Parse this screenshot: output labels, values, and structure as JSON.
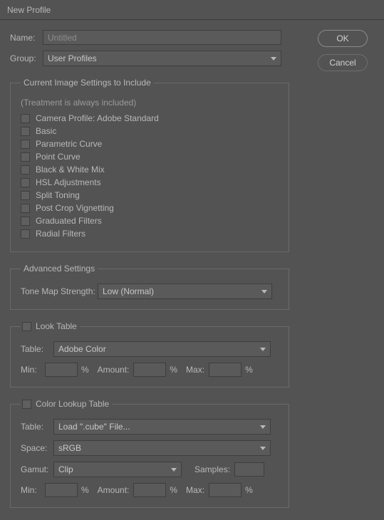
{
  "window": {
    "title": "New Profile"
  },
  "form": {
    "name_label": "Name:",
    "name_placeholder": "Untitled",
    "name_value": "",
    "group_label": "Group:",
    "group_value": "User Profiles"
  },
  "include": {
    "legend": "Current Image Settings to Include",
    "note": "(Treatment is always included)",
    "items": [
      "Camera Profile: Adobe Standard",
      "Basic",
      "Parametric Curve",
      "Point Curve",
      "Black & White Mix",
      "HSL Adjustments",
      "Split Toning",
      "Post Crop Vignetting",
      "Graduated Filters",
      "Radial Filters"
    ]
  },
  "advanced": {
    "legend": "Advanced Settings",
    "tone_map_label": "Tone Map Strength:",
    "tone_map_value": "Low (Normal)"
  },
  "look": {
    "legend": "Look Table",
    "table_label": "Table:",
    "table_value": "Adobe Color",
    "min_label": "Min:",
    "amount_label": "Amount:",
    "max_label": "Max:",
    "pct": "%"
  },
  "clut": {
    "legend": "Color Lookup Table",
    "table_label": "Table:",
    "table_value": "Load \".cube\" File...",
    "space_label": "Space:",
    "space_value": "sRGB",
    "gamut_label": "Gamut:",
    "gamut_value": "Clip",
    "samples_label": "Samples:",
    "min_label": "Min:",
    "amount_label": "Amount:",
    "max_label": "Max:",
    "pct": "%"
  },
  "buttons": {
    "ok": "OK",
    "cancel": "Cancel"
  }
}
